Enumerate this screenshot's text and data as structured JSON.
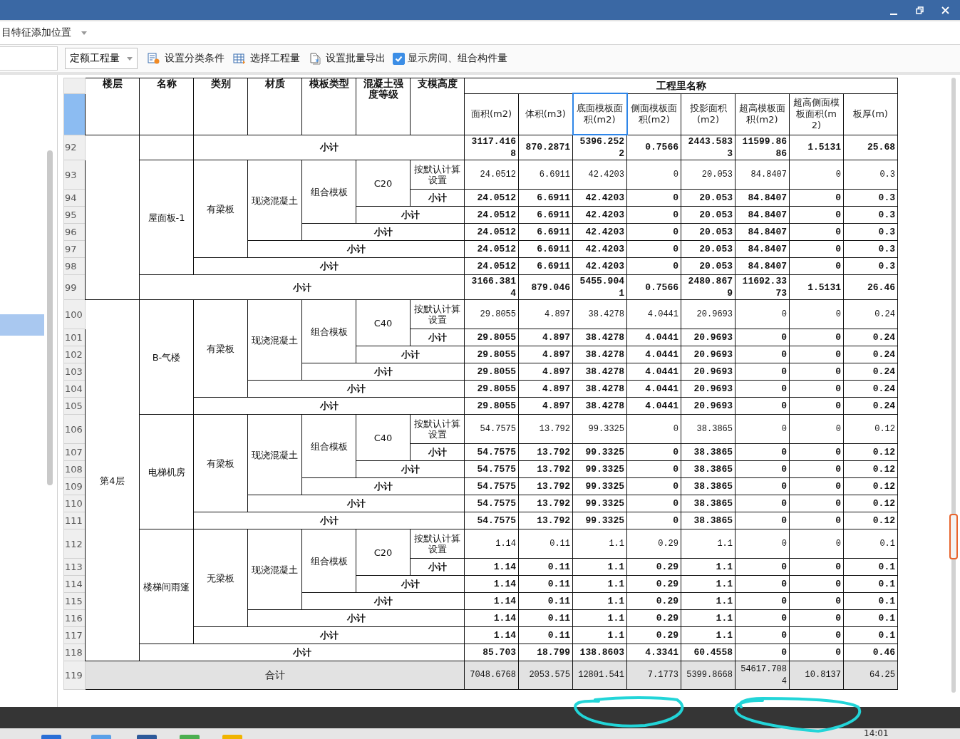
{
  "top_bar": {
    "dropdown": "目特征添加位置"
  },
  "toolbar": {
    "dropdown": "定额工程量",
    "buttons": [
      {
        "kind": "classify",
        "label": "设置分类条件"
      },
      {
        "kind": "select",
        "label": "选择工程量"
      },
      {
        "kind": "export",
        "label": "设置批量导出"
      }
    ],
    "checkbox": {
      "label": "显示房间、组合构件量",
      "checked": true
    }
  },
  "left_panel": {
    "has_selection": true
  },
  "table": {
    "header_row_selected": true,
    "columns": [
      "楼层",
      "名称",
      "类别",
      "材质",
      "模板类型",
      "混凝土强度等级",
      "支模高度"
    ],
    "group_title": "工程里名称",
    "value_columns": [
      {
        "label": "面积(m2)",
        "selected": false
      },
      {
        "label": "体积(m3)",
        "selected": false
      },
      {
        "label": "底面模板面积(m2)",
        "selected": true
      },
      {
        "label": "侧面模板面积(m2)",
        "selected": false
      },
      {
        "label": "投影面积(m2)",
        "selected": false
      },
      {
        "label": "超高模板面积(m2)",
        "selected": false
      },
      {
        "label": "超高侧面模板面积(m2)",
        "selected": false
      },
      {
        "label": "板厚(m)",
        "selected": false
      }
    ],
    "floors": [
      {
        "children": [
          {
            "subtotal": {
              "no": "92",
              "label": "小计",
              "values": [
                "3117.4168",
                "870.2871",
                "5396.2522",
                "0.7566",
                "2443.5833",
                "11599.8686",
                "1.5131",
                "25.68"
              ]
            }
          },
          {
            "label": "屋面板-1",
            "children": [
              {
                "label": "有梁板",
                "children": [
                  {
                    "label": "现浇混凝土",
                    "children": [
                      {
                        "label": "组合模板",
                        "children": [
                          {
                            "label": "C20",
                            "children": [
                              {
                                "label": "按默认计算设置",
                                "no": "93",
                                "values": [
                                  "24.0512",
                                  "6.6911",
                                  "42.4203",
                                  "0",
                                  "20.053",
                                  "84.8407",
                                  "0",
                                  "0.3"
                                ]
                              }
                            ],
                            "subtotal": {
                              "no": "94",
                              "label": "小计",
                              "values": [
                                "24.0512",
                                "6.6911",
                                "42.4203",
                                "0",
                                "20.053",
                                "84.8407",
                                "0",
                                "0.3"
                              ]
                            }
                          }
                        ],
                        "subtotal": {
                          "no": "95",
                          "label": "小计",
                          "values": [
                            "24.0512",
                            "6.6911",
                            "42.4203",
                            "0",
                            "20.053",
                            "84.8407",
                            "0",
                            "0.3"
                          ]
                        }
                      }
                    ],
                    "subtotal": {
                      "no": "96",
                      "label": "小计",
                      "values": [
                        "24.0512",
                        "6.6911",
                        "42.4203",
                        "0",
                        "20.053",
                        "84.8407",
                        "0",
                        "0.3"
                      ]
                    }
                  }
                ],
                "subtotal": {
                  "no": "97",
                  "label": "小计",
                  "values": [
                    "24.0512",
                    "6.6911",
                    "42.4203",
                    "0",
                    "20.053",
                    "84.8407",
                    "0",
                    "0.3"
                  ]
                }
              }
            ],
            "subtotal": {
              "no": "98",
              "label": "小计",
              "values": [
                "24.0512",
                "6.6911",
                "42.4203",
                "0",
                "20.053",
                "84.8407",
                "0",
                "0.3"
              ]
            }
          }
        ],
        "subtotal": {
          "no": "99",
          "label": "小计",
          "values": [
            "3166.3814",
            "879.046",
            "5455.9041",
            "0.7566",
            "2480.8679",
            "11692.3373",
            "1.5131",
            "26.46"
          ]
        }
      },
      {
        "label": "第4层",
        "children": [
          {
            "label": "B-气楼",
            "children": [
              {
                "label": "有梁板",
                "children": [
                  {
                    "label": "现浇混凝土",
                    "children": [
                      {
                        "label": "组合模板",
                        "children": [
                          {
                            "label": "C40",
                            "children": [
                              {
                                "label": "按默认计算设置",
                                "no": "100",
                                "values": [
                                  "29.8055",
                                  "4.897",
                                  "38.4278",
                                  "4.0441",
                                  "20.9693",
                                  "0",
                                  "0",
                                  "0.24"
                                ]
                              }
                            ],
                            "subtotal": {
                              "no": "101",
                              "label": "小计",
                              "values": [
                                "29.8055",
                                "4.897",
                                "38.4278",
                                "4.0441",
                                "20.9693",
                                "0",
                                "0",
                                "0.24"
                              ]
                            }
                          }
                        ],
                        "subtotal": {
                          "no": "102",
                          "label": "小计",
                          "values": [
                            "29.8055",
                            "4.897",
                            "38.4278",
                            "4.0441",
                            "20.9693",
                            "0",
                            "0",
                            "0.24"
                          ]
                        }
                      }
                    ],
                    "subtotal": {
                      "no": "103",
                      "label": "小计",
                      "values": [
                        "29.8055",
                        "4.897",
                        "38.4278",
                        "4.0441",
                        "20.9693",
                        "0",
                        "0",
                        "0.24"
                      ]
                    }
                  }
                ],
                "subtotal": {
                  "no": "104",
                  "label": "小计",
                  "values": [
                    "29.8055",
                    "4.897",
                    "38.4278",
                    "4.0441",
                    "20.9693",
                    "0",
                    "0",
                    "0.24"
                  ]
                }
              }
            ],
            "subtotal": {
              "no": "105",
              "label": "小计",
              "values": [
                "29.8055",
                "4.897",
                "38.4278",
                "4.0441",
                "20.9693",
                "0",
                "0",
                "0.24"
              ]
            }
          },
          {
            "label": "电梯机房",
            "children": [
              {
                "label": "有梁板",
                "children": [
                  {
                    "label": "现浇混凝土",
                    "children": [
                      {
                        "label": "组合模板",
                        "children": [
                          {
                            "label": "C40",
                            "children": [
                              {
                                "label": "按默认计算设置",
                                "no": "106",
                                "values": [
                                  "54.7575",
                                  "13.792",
                                  "99.3325",
                                  "0",
                                  "38.3865",
                                  "0",
                                  "0",
                                  "0.12"
                                ]
                              }
                            ],
                            "subtotal": {
                              "no": "107",
                              "label": "小计",
                              "values": [
                                "54.7575",
                                "13.792",
                                "99.3325",
                                "0",
                                "38.3865",
                                "0",
                                "0",
                                "0.12"
                              ]
                            }
                          }
                        ],
                        "subtotal": {
                          "no": "108",
                          "label": "小计",
                          "values": [
                            "54.7575",
                            "13.792",
                            "99.3325",
                            "0",
                            "38.3865",
                            "0",
                            "0",
                            "0.12"
                          ]
                        }
                      }
                    ],
                    "subtotal": {
                      "no": "109",
                      "label": "小计",
                      "values": [
                        "54.7575",
                        "13.792",
                        "99.3325",
                        "0",
                        "38.3865",
                        "0",
                        "0",
                        "0.12"
                      ]
                    }
                  }
                ],
                "subtotal": {
                  "no": "110",
                  "label": "小计",
                  "values": [
                    "54.7575",
                    "13.792",
                    "99.3325",
                    "0",
                    "38.3865",
                    "0",
                    "0",
                    "0.12"
                  ]
                }
              }
            ],
            "subtotal": {
              "no": "111",
              "label": "小计",
              "values": [
                "54.7575",
                "13.792",
                "99.3325",
                "0",
                "38.3865",
                "0",
                "0",
                "0.12"
              ]
            }
          },
          {
            "label": "楼梯间雨篷",
            "children": [
              {
                "label": "无梁板",
                "children": [
                  {
                    "label": "现浇混凝土",
                    "children": [
                      {
                        "label": "组合模板",
                        "children": [
                          {
                            "label": "C20",
                            "children": [
                              {
                                "label": "按默认计算设置",
                                "no": "112",
                                "values": [
                                  "1.14",
                                  "0.11",
                                  "1.1",
                                  "0.29",
                                  "1.1",
                                  "0",
                                  "0",
                                  "0.1"
                                ]
                              }
                            ],
                            "subtotal": {
                              "no": "113",
                              "label": "小计",
                              "values": [
                                "1.14",
                                "0.11",
                                "1.1",
                                "0.29",
                                "1.1",
                                "0",
                                "0",
                                "0.1"
                              ]
                            }
                          }
                        ],
                        "subtotal": {
                          "no": "114",
                          "label": "小计",
                          "values": [
                            "1.14",
                            "0.11",
                            "1.1",
                            "0.29",
                            "1.1",
                            "0",
                            "0",
                            "0.1"
                          ]
                        }
                      }
                    ],
                    "subtotal": {
                      "no": "115",
                      "label": "小计",
                      "values": [
                        "1.14",
                        "0.11",
                        "1.1",
                        "0.29",
                        "1.1",
                        "0",
                        "0",
                        "0.1"
                      ]
                    }
                  }
                ],
                "subtotal": {
                  "no": "116",
                  "label": "小计",
                  "values": [
                    "1.14",
                    "0.11",
                    "1.1",
                    "0.29",
                    "1.1",
                    "0",
                    "0",
                    "0.1"
                  ]
                }
              }
            ],
            "subtotal": {
              "no": "117",
              "label": "小计",
              "values": [
                "1.14",
                "0.11",
                "1.1",
                "0.29",
                "1.1",
                "0",
                "0",
                "0.1"
              ]
            }
          }
        ],
        "subtotal": {
          "no": "118",
          "label": "小计",
          "values": [
            "85.703",
            "18.799",
            "138.8603",
            "4.3341",
            "60.4558",
            "0",
            "0",
            "0.46"
          ]
        }
      }
    ],
    "total": {
      "no": "119",
      "label": "合计",
      "values": [
        "7048.6768",
        "2053.575",
        "12801.541",
        "7.1773",
        "5399.8668",
        "54617.7084",
        "10.8137",
        "64.25"
      ]
    }
  },
  "taskbar": {
    "clock": "14:01"
  },
  "annotations": [
    {
      "kind": "circle"
    },
    {
      "kind": "circle"
    }
  ]
}
